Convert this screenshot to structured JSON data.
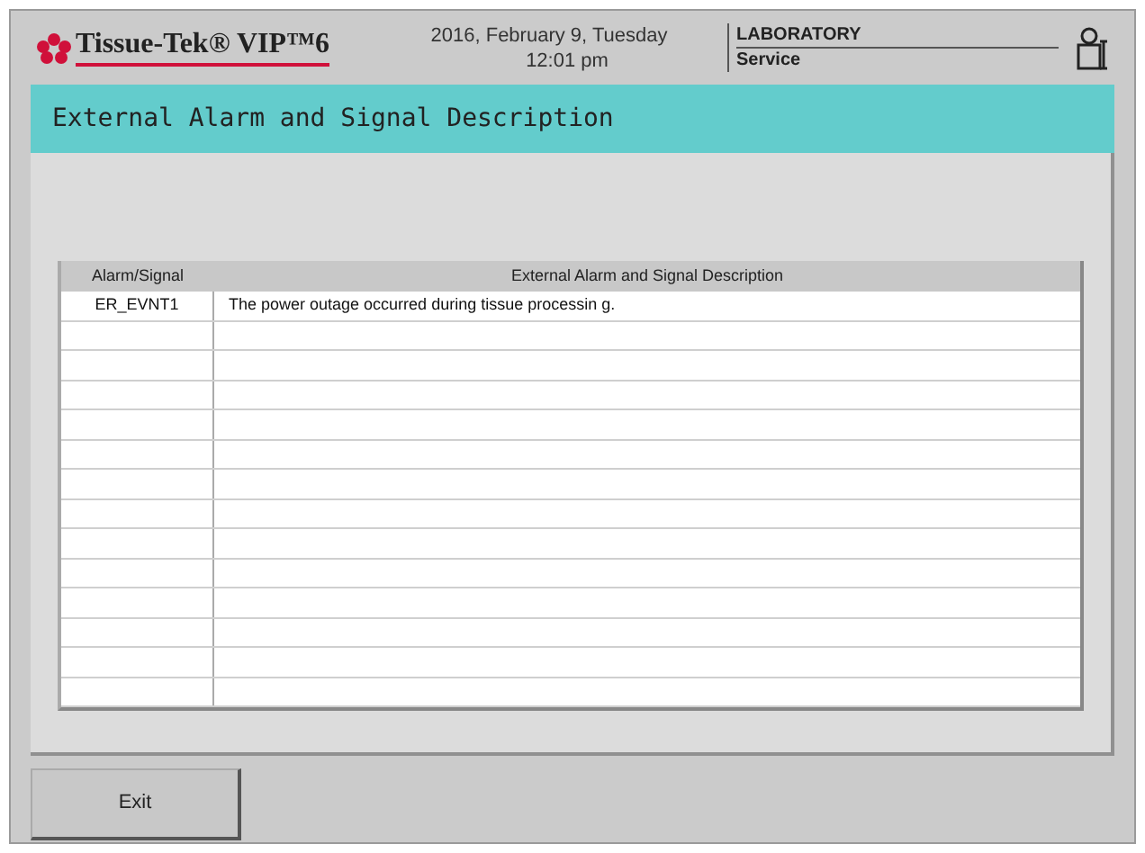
{
  "header": {
    "logo": "Tissue-Tek® VIP™6",
    "date": "2016, February 9, Tuesday",
    "time": "12:01 pm",
    "mode": "LABORATORY",
    "user": "Service"
  },
  "title": "External Alarm and Signal Description",
  "table": {
    "columns": [
      "Alarm/Signal",
      "External Alarm and Signal Description"
    ],
    "rows": [
      {
        "signal": "ER_EVNT1",
        "description": "The power outage occurred during tissue processin g."
      }
    ]
  },
  "buttons": [
    "Exit"
  ]
}
